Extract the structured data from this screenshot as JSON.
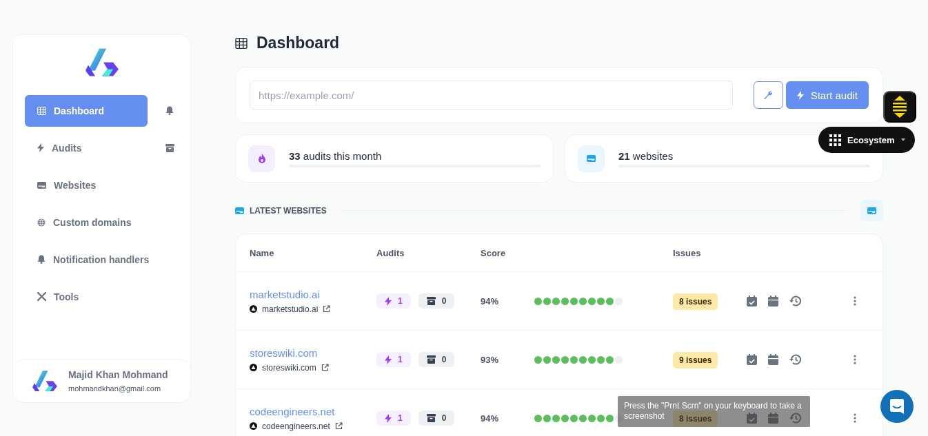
{
  "sidebar": {
    "nav": [
      {
        "label": "Dashboard",
        "selected": true
      },
      {
        "label": "Audits",
        "selected": false
      },
      {
        "label": "Websites",
        "selected": false
      },
      {
        "label": "Custom domains",
        "selected": false
      },
      {
        "label": "Notification handlers",
        "selected": false
      },
      {
        "label": "Tools",
        "selected": false
      }
    ],
    "user": {
      "name": "Majid Khan Mohmand",
      "email": "mohmandkhan@gmail.com"
    }
  },
  "page_title": "Dashboard",
  "audit_form": {
    "placeholder": "https://example.com/",
    "button": "Start audit"
  },
  "stats": [
    {
      "count": "33",
      "label": "audits this month",
      "level": 0
    },
    {
      "count": "21",
      "label": "websites",
      "level": 0
    }
  ],
  "section_title": "LATEST WEBSITES",
  "table": {
    "columns": [
      "Name",
      "Audits",
      "Score",
      "Issues"
    ],
    "rows": [
      {
        "name": "marketstudio.ai",
        "domain": "marketstudio.ai",
        "audits": "1",
        "archived": "0",
        "score": "94%",
        "stars": 9,
        "issues": "8 issues"
      },
      {
        "name": "storeswiki.com",
        "domain": "storeswiki.com",
        "audits": "1",
        "archived": "0",
        "score": "93%",
        "stars": 9,
        "issues": "9 issues"
      },
      {
        "name": "codeengineers.net",
        "domain": "codeengineers.net",
        "audits": "1",
        "archived": "0",
        "score": "94%",
        "stars": 9,
        "issues": "8 issues"
      }
    ]
  },
  "ecosystem": {
    "label": "Ecosystem"
  },
  "tooltip": "Press the \"Prnt Scrn\" on your keyboard to take a screenshot"
}
